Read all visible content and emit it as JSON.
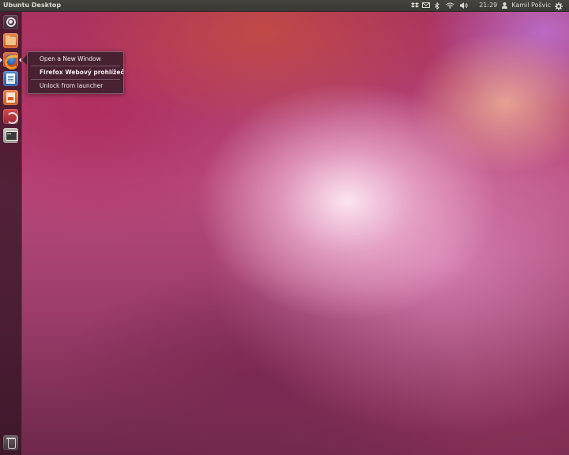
{
  "top_panel": {
    "title": "Ubuntu Desktop",
    "clock": "21:29",
    "user_name": "Kamil Pošvic",
    "indicators": [
      "dropbox-icon",
      "mail-icon",
      "bluetooth-icon",
      "wifi-icon",
      "volume-icon",
      "user-icon",
      "gear-icon"
    ]
  },
  "launcher": {
    "items": [
      {
        "name": "dash-home",
        "icon": "ubuntu-logo-icon"
      },
      {
        "name": "files",
        "icon": "folder-icon"
      },
      {
        "name": "firefox",
        "icon": "firefox-icon",
        "active": true
      },
      {
        "name": "libreoffice-writer",
        "icon": "writer-icon"
      },
      {
        "name": "libreoffice-impress",
        "icon": "impress-icon"
      },
      {
        "name": "ubuntu-one",
        "icon": "ubuntu-one-icon"
      },
      {
        "name": "terminal",
        "icon": "terminal-icon"
      },
      {
        "name": "trash",
        "icon": "trash-icon"
      }
    ]
  },
  "quicklist": {
    "items": [
      {
        "label": "Open a New Window"
      },
      {
        "label": "Firefox Webový prohlížeč"
      },
      {
        "label": "Unlock from launcher"
      }
    ]
  },
  "colors": {
    "panel_bg": "#3c3b37",
    "panel_text": "#dfdbd2",
    "launcher_bg": "#2d1220",
    "wallpaper_accent": "#b84a7c"
  }
}
